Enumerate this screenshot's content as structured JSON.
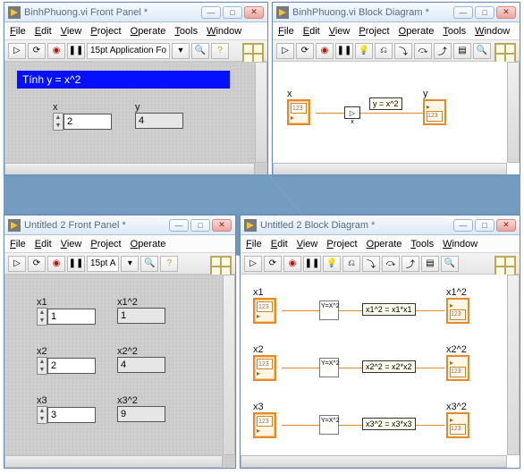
{
  "win1": {
    "title": "BinhPhuong.vi Front Panel *",
    "menu": [
      "File",
      "Edit",
      "View",
      "Project",
      "Operate",
      "Tools",
      "Window"
    ],
    "fontField": "15pt Application Fo",
    "banner": "Tính y = x^2",
    "lbl_x": "x",
    "lbl_y": "y",
    "val_x": "2",
    "val_y": "4"
  },
  "win2": {
    "title": "BinhPhuong.vi Block Diagram *",
    "menu": [
      "File",
      "Edit",
      "View",
      "Project",
      "Operate",
      "Tools",
      "Window"
    ],
    "lbl_x": "x",
    "lbl_y": "y",
    "op": "x",
    "formula": "y = x^2",
    "val123": "123"
  },
  "win3": {
    "title": "Untitled 2 Front Panel *",
    "menu": [
      "File",
      "Edit",
      "View",
      "Project",
      "Operate"
    ],
    "fontField": "15pt A",
    "rows": [
      {
        "lblIn": "x1",
        "valIn": "1",
        "lblOut": "x1^2",
        "valOut": "1"
      },
      {
        "lblIn": "x2",
        "valIn": "2",
        "lblOut": "x2^2",
        "valOut": "4"
      },
      {
        "lblIn": "x3",
        "valIn": "3",
        "lblOut": "x3^2",
        "valOut": "9"
      }
    ]
  },
  "win4": {
    "title": "Untitled 2 Block Diagram *",
    "menu": [
      "File",
      "Edit",
      "View",
      "Project",
      "Operate",
      "Tools",
      "Window"
    ],
    "subvi": "Y=X^2",
    "rows": [
      {
        "lblIn": "x1",
        "lblOut": "x1^2",
        "formula": "x1^2 = x1*x1"
      },
      {
        "lblIn": "x2",
        "lblOut": "x2^2",
        "formula": "x2^2 = x2*x2"
      },
      {
        "lblIn": "x3",
        "lblOut": "x3^2",
        "formula": "x3^2 = x3*x3"
      }
    ],
    "val123": "123"
  },
  "winbtn": {
    "min": "—",
    "max": "□",
    "close": "✕"
  }
}
